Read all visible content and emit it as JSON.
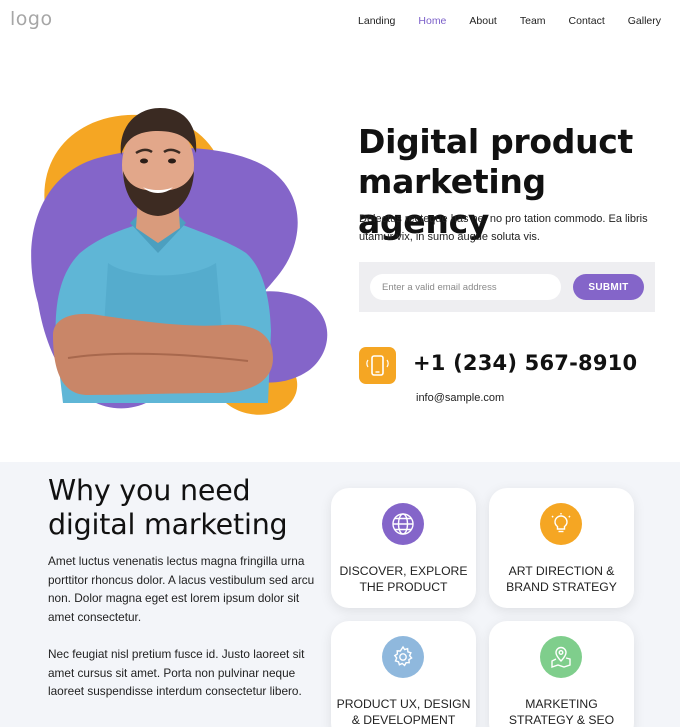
{
  "nav": {
    "logo": "logo",
    "items": [
      {
        "label": "Landing",
        "active": false
      },
      {
        "label": "Home",
        "active": true
      },
      {
        "label": "About",
        "active": false
      },
      {
        "label": "Team",
        "active": false
      },
      {
        "label": "Contact",
        "active": false
      },
      {
        "label": "Gallery",
        "active": false
      }
    ]
  },
  "hero": {
    "title_line1": "Digital product",
    "title_line2": "marketing agency",
    "subtitle": "Delectus recteque has ne, no pro tation commodo. Ea libris utamur vix, in sumo augue soluta vis.",
    "email_placeholder": "Enter a valid email address",
    "submit_label": "SUBMIT",
    "phone": "+1 (234) 567-8910",
    "email": "info@sample.com"
  },
  "why": {
    "title_line1": "Why you need",
    "title_line2": "digital marketing",
    "paragraph1": "Amet luctus venenatis lectus magna fringilla urna porttitor rhoncus dolor. A lacus vestibulum sed arcu non. Dolor magna eget est lorem ipsum dolor sit amet consectetur.",
    "paragraph2": "Nec feugiat nisl pretium fusce id. Justo laoreet sit amet cursus sit amet. Porta non pulvinar neque laoreet suspendisse interdum consectetur libero."
  },
  "cards": [
    {
      "line1": "DISCOVER, EXPLORE",
      "line2": "THE PRODUCT",
      "icon": "globe-icon",
      "color": "#8465c9"
    },
    {
      "line1": "ART DIRECTION &",
      "line2": "BRAND STRATEGY",
      "icon": "lightbulb-icon",
      "color": "#f5a623"
    },
    {
      "line1": "PRODUCT UX, DESIGN",
      "line2": "& DEVELOPMENT",
      "icon": "gear-icon",
      "color": "#8fb8dd"
    },
    {
      "line1": "MARKETING",
      "line2": "STRATEGY & SEO",
      "icon": "map-pin-icon",
      "color": "#7fce8c"
    }
  ],
  "colors": {
    "accent_purple": "#8465c9",
    "accent_orange": "#f5a623",
    "section_bg": "#f3f5f9"
  }
}
